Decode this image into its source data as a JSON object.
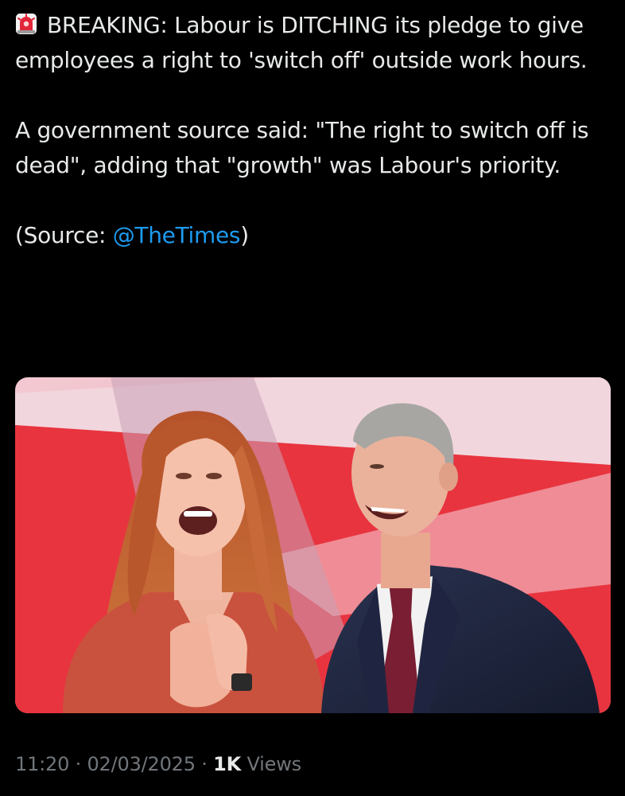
{
  "tweet": {
    "paragraphs": {
      "breaking": "BREAKING: Labour is DITCHING its pledge to give employees a right to 'switch off' outside work hours.",
      "quote": "A government source said: \"The right to switch off is dead\", adding that \"growth\" was Labour's priority.",
      "source_prefix": "(Source: ",
      "source_mention": "@TheTimes",
      "source_suffix": ")"
    },
    "icons": {
      "lead": "police-siren-icon"
    },
    "media": {
      "kind": "photo"
    },
    "meta": {
      "time": "11:20",
      "separator": "·",
      "date": "02/03/2025",
      "views_count": "1K",
      "views_label": "Views"
    }
  },
  "colors": {
    "background": "#000000",
    "text": "#e7e9ea",
    "muted": "#71767b",
    "link": "#1d9bf0",
    "backdrop_red": "#e8343f",
    "backdrop_pink": "#f1c7d0"
  }
}
